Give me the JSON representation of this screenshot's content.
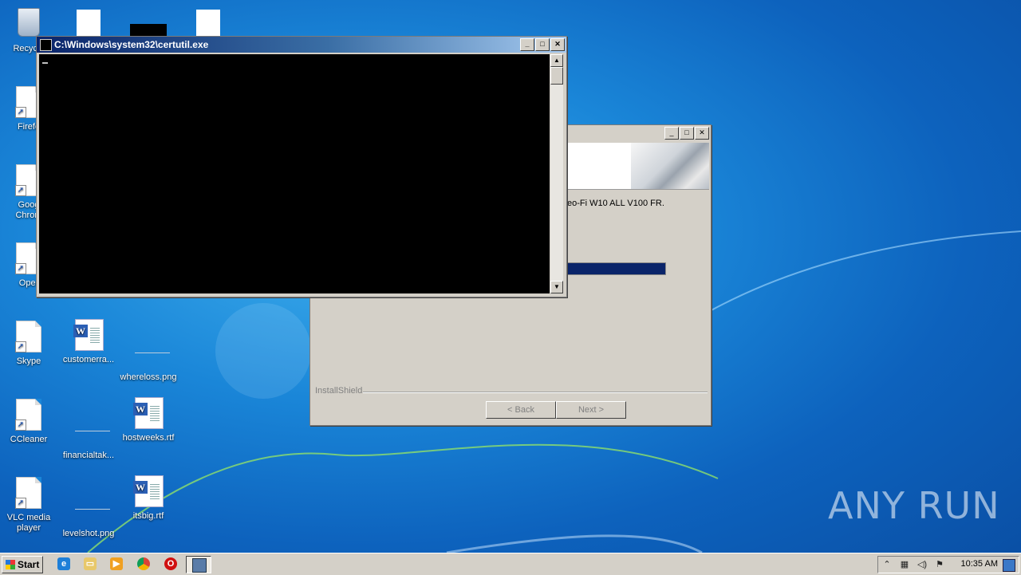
{
  "desktop": {
    "icons": [
      {
        "label": "Recycle",
        "kind": "recycle"
      },
      {
        "label": "Firefo",
        "kind": "shortcut"
      },
      {
        "label": "Goog\nChrom",
        "kind": "shortcut"
      },
      {
        "label": "Oper",
        "kind": "shortcut"
      },
      {
        "label": "Skype",
        "kind": "shortcut"
      },
      {
        "label": "customerra...",
        "kind": "word"
      },
      {
        "label": "whereloss.png",
        "kind": "blank"
      },
      {
        "label": "CCleaner",
        "kind": "shortcut"
      },
      {
        "label": "financialtak...",
        "kind": "blank"
      },
      {
        "label": "hostweeks.rtf",
        "kind": "word"
      },
      {
        "label": "VLC media player",
        "kind": "shortcut"
      },
      {
        "label": "levelshot.png",
        "kind": "blank"
      },
      {
        "label": "itsbig.rtf",
        "kind": "word"
      }
    ]
  },
  "console": {
    "title": "C:\\Windows\\system32\\certutil.exe",
    "cursor": "_"
  },
  "installer": {
    "message": "eo-Fi W10 ALL V100 FR.",
    "progress_pct": 100,
    "brand": "InstallShield",
    "back_label": "< Back",
    "next_label": "Next >"
  },
  "taskbar": {
    "start_label": "Start",
    "clock": "10:35 AM"
  },
  "watermark": "ANY RUN"
}
